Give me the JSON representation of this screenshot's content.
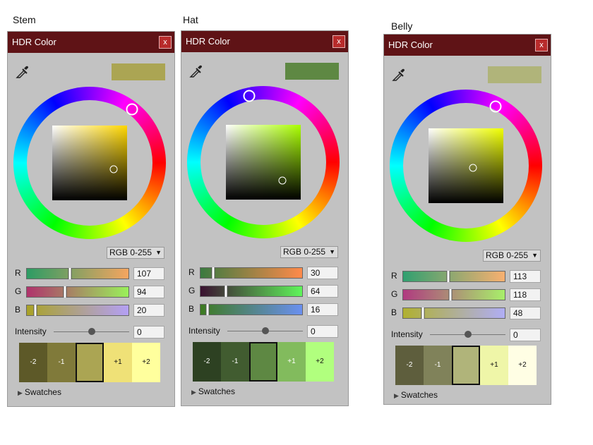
{
  "panels": [
    {
      "label": "Stem",
      "title": "HDR Color",
      "close": "x",
      "preview": "#aba553",
      "hue_color": "#ffd700",
      "mode": "RGB 0-255",
      "channels": [
        {
          "label": "R",
          "value": "107",
          "grad": "linear-gradient(to right,#2c9c64,#f5a560)"
        },
        {
          "label": "G",
          "value": "94",
          "grad": "linear-gradient(to right,#b0326c,#9af05a)"
        },
        {
          "label": "B",
          "value": "20",
          "grad": "linear-gradient(to right,#a9a226,#b4a0f5)"
        }
      ],
      "intensity_label": "Intensity",
      "intensity": "0",
      "swatches": [
        {
          "label": "-2",
          "color": "#5d5928",
          "text": "#ffffff"
        },
        {
          "label": "-1",
          "color": "#807a3a",
          "text": "#ffffff"
        },
        {
          "label": "",
          "color": "#aba553",
          "text": "#111111"
        },
        {
          "label": "+1",
          "color": "#efe177",
          "text": "#111111"
        },
        {
          "label": "+2",
          "color": "#ffff9d",
          "text": "#111111"
        }
      ],
      "swatches_label": "Swatches"
    },
    {
      "label": "Hat",
      "title": "HDR Color",
      "close": "x",
      "preview": "#5e8843",
      "hue_color": "#aaff00",
      "mode": "RGB 0-255",
      "channels": [
        {
          "label": "R",
          "value": "30",
          "grad": "linear-gradient(to right,#3a7a40,#ff8a4a)"
        },
        {
          "label": "G",
          "value": "64",
          "grad": "linear-gradient(to right,#3a1030,#5ff55a)"
        },
        {
          "label": "B",
          "value": "16",
          "grad": "linear-gradient(to right,#3d7a20,#6a90f0)"
        }
      ],
      "intensity_label": "Intensity",
      "intensity": "0",
      "swatches": [
        {
          "label": "-2",
          "color": "#2d4122",
          "text": "#ffffff"
        },
        {
          "label": "-1",
          "color": "#415c30",
          "text": "#ffffff"
        },
        {
          "label": "",
          "color": "#5e8843",
          "text": "#111111"
        },
        {
          "label": "+1",
          "color": "#82bb5d",
          "text": "#ffffff"
        },
        {
          "label": "+2",
          "color": "#b1ff7e",
          "text": "#111111"
        }
      ],
      "swatches_label": "Swatches"
    },
    {
      "label": "Belly",
      "title": "HDR Color",
      "close": "x",
      "preview": "#b0b47a",
      "hue_color": "#f0ff00",
      "mode": "RGB 0-255",
      "channels": [
        {
          "label": "R",
          "value": "113",
          "grad": "linear-gradient(to right,#30a070,#f8b070)"
        },
        {
          "label": "G",
          "value": "118",
          "grad": "linear-gradient(to right,#b03a80,#a8ef6a)"
        },
        {
          "label": "B",
          "value": "48",
          "grad": "linear-gradient(to right,#b0b030,#b0aef5)"
        }
      ],
      "intensity_label": "Intensity",
      "intensity": "0",
      "swatches": [
        {
          "label": "-2",
          "color": "#5e5e3d",
          "text": "#ffffff"
        },
        {
          "label": "-1",
          "color": "#80825a",
          "text": "#ffffff"
        },
        {
          "label": "",
          "color": "#b0b47a",
          "text": "#111111"
        },
        {
          "label": "+1",
          "color": "#eff6a8",
          "text": "#111111"
        },
        {
          "label": "+2",
          "color": "#fffee4",
          "text": "#111111"
        }
      ],
      "swatches_label": "Swatches"
    }
  ]
}
